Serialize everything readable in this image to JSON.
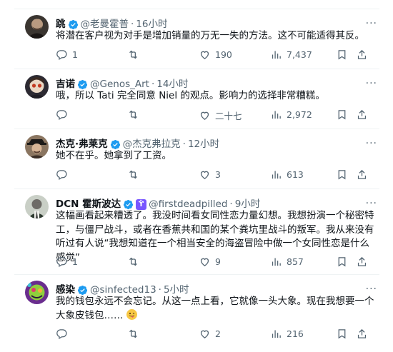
{
  "more_glyph": "···",
  "tweets": [
    {
      "name": "跳",
      "handle": "@老曼霍普",
      "time": "16小时",
      "text": "将潜在客户视为对手是增加销量的万无一失的方法。这不可能适得其反。",
      "replies": "1",
      "reposts": "",
      "likes": "190",
      "views": "7,437"
    },
    {
      "name": "吉诺",
      "handle": "@Genos_Art",
      "time": "14小时",
      "text": "哦，所以 Tati 完全同意 Niel 的观点。影响力的选择非常糟糕。",
      "replies": "",
      "reposts": "",
      "likes": "二十七",
      "views": "2,972"
    },
    {
      "name": "杰克·弗莱克",
      "handle": "@杰克弗拉克",
      "time": "12小时",
      "text": "她不在乎。她拿到了工资。",
      "replies": "",
      "reposts": "",
      "likes": "3",
      "views": "613"
    },
    {
      "name": "DCN 霍斯波达",
      "badge": "ϔ",
      "handle": "@firstdeadpilled",
      "time": "9小时",
      "text": "这幅画看起来糟透了。我没时间看女同性恋力量幻想。我想扮演一个秘密特工，与僵尸战斗，或者在香蕉共和国的某个粪坑里战斗的叛军。我从来没有听过有人说“我想知道在一个相当安全的海盗冒险中做一个女同性恋是什么感觉”",
      "replies": "1",
      "reposts": "",
      "likes": "9",
      "views": "857"
    },
    {
      "name": "感染",
      "handle": "@sinfected13",
      "time": "5小时",
      "text": "我的钱包永远不会忘记。从这一点上看，它就像一头大象。现在我想要一个大象皮钱包……",
      "replies": "",
      "reposts": "",
      "likes": "2",
      "views": "216"
    }
  ],
  "colors": {
    "text": "#0f1419",
    "muted": "#536471",
    "verified": "#1d9bf0",
    "separator": "#eff3f4"
  }
}
